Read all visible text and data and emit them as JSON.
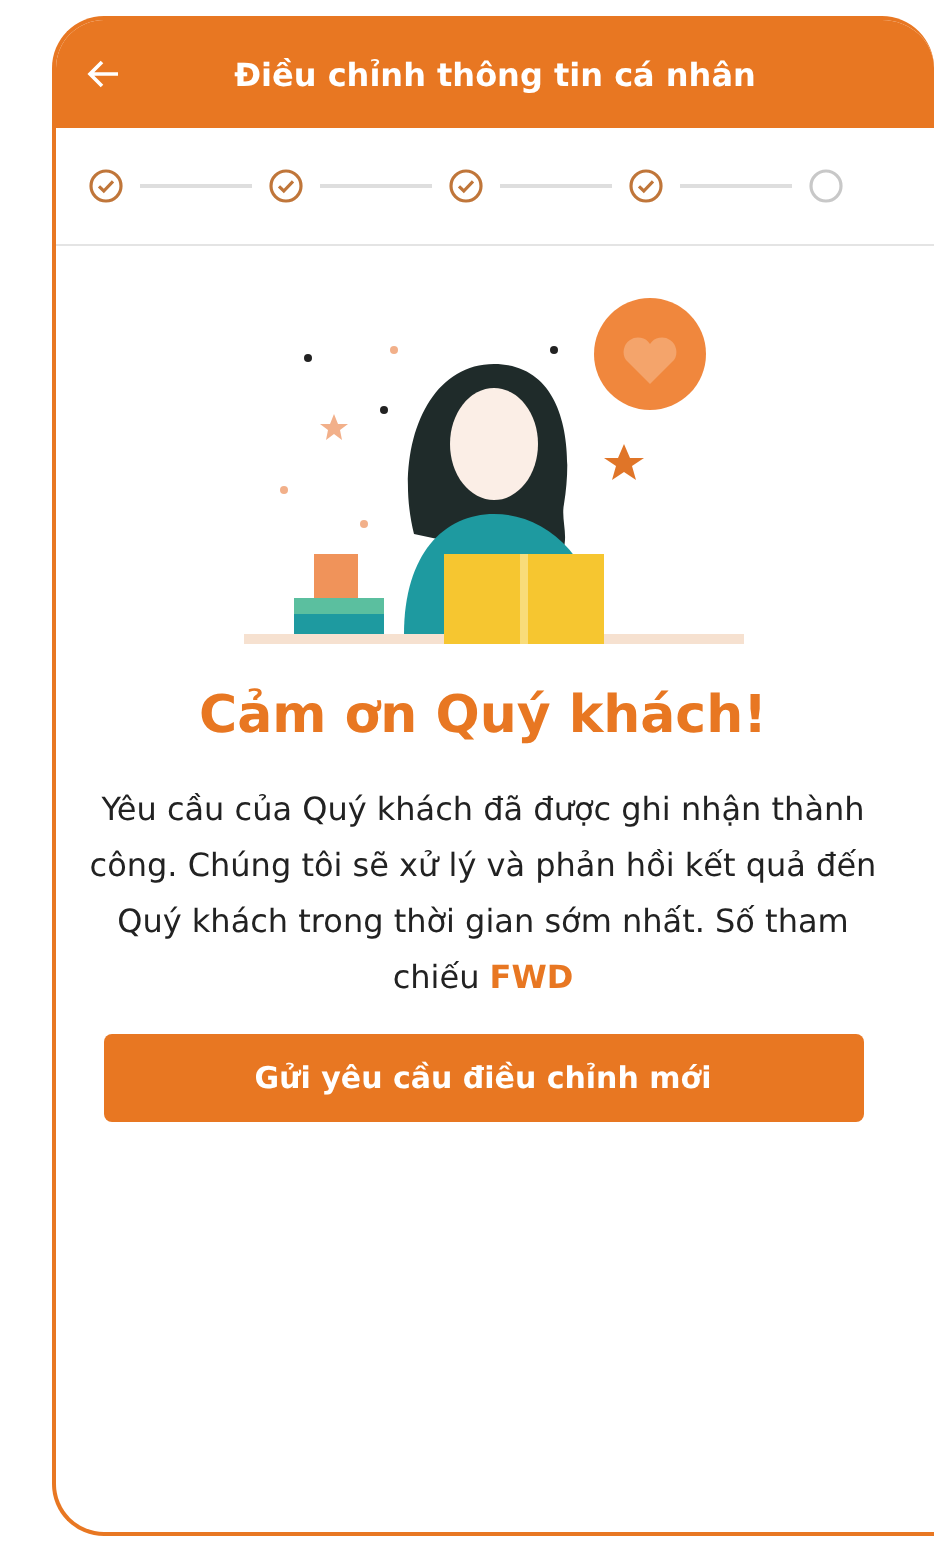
{
  "header": {
    "title": "Điều chỉnh thông tin cá nhân"
  },
  "steps": [
    {
      "done": true
    },
    {
      "done": true
    },
    {
      "done": true
    },
    {
      "done": true
    },
    {
      "done": false
    }
  ],
  "title": "Cảm ơn Quý khách!",
  "message": "Yêu cầu của Quý khách đã được ghi nhận thành công. Chúng tôi sẽ xử lý và phản hồi kết quả đến Quý khách trong thời gian sớm nhất. Số tham chiếu **FWD**",
  "button": "Gửi yêu cầu điều chỉnh mới"
}
